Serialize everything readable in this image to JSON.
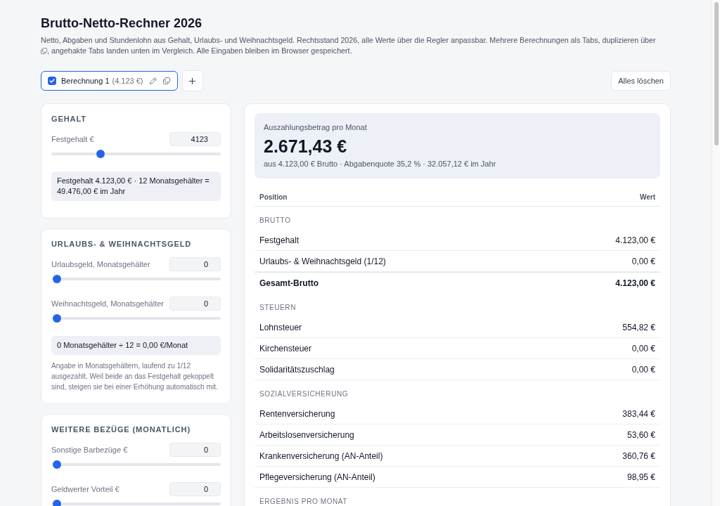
{
  "page": {
    "title": "Brutto-Netto-Rechner 2026",
    "description": {
      "before_icon": "Netto, Abgaben und Stundenlohn aus Gehalt, Urlaubs- und Weihnachtsgeld. Rechtsstand 2026, alle Werte über die Regler anpassbar. Mehrere Berechnungen als Tabs, duplizieren über",
      "after_icon": ", angehakte Tabs landen unten im Vergleich. Alle Eingaben bleiben im Browser gespeichert."
    }
  },
  "tabs": [
    {
      "label": "Berechnung 1",
      "amount": "(4.123 €)",
      "checked": true,
      "selected": true
    }
  ],
  "toolbar": {
    "clear_button": "Alles löschen"
  },
  "input_cards": [
    {
      "title": "GEHALT",
      "fields": [
        {
          "label": "Festgehalt €",
          "value": "4123",
          "level": 0.275
        }
      ],
      "formula": "Festgehalt 4.123,00 € · 12 Monatsgehälter = 49.476,00 € im Jahr"
    },
    {
      "title": "URLAUBS- & WEIHNACHTSGELD",
      "fields": [
        {
          "label": "Urlaubsgeld, Monatsgehälter",
          "value": "0",
          "level": 0
        },
        {
          "label": "Weihnachtsgeld, Monatsgehälter",
          "value": "0",
          "level": 0
        }
      ],
      "formula": "0 Monatsgehälter ÷ 12 = 0,00 €/Monat",
      "note": "Angabe in Monatsgehältern, laufend zu 1/12 ausgezahlt. Weil beide an das Festgehalt gekoppelt sind, steigen sie bei einer Erhöhung automatisch mit."
    },
    {
      "title": "WEITERE BEZÜGE (MONATLICH)",
      "fields": [
        {
          "label": "Sonstige Barbezüge €",
          "value": "0",
          "level": 0
        },
        {
          "label": "Geldwerter Vorteil €",
          "value": "0",
          "level": 0
        }
      ]
    }
  ],
  "result": {
    "summary": {
      "label": "Auszahlungsbetrag pro Monat",
      "amount": "2.671,43 €",
      "details": "aus 4.123,00 € Brutto · Abgabenquote 35,2 % · 32.057,12 € im Jahr"
    },
    "table": {
      "columns": [
        "Position",
        "Wert"
      ],
      "sections": [
        {
          "title": "BRUTTO",
          "rows": [
            {
              "label": "Festgehalt",
              "value": "4.123,00 €",
              "kind": "item"
            },
            {
              "label": "Urlaubs- & Weihnachtsgeld (1/12)",
              "value": "0,00 €",
              "kind": "item"
            },
            {
              "label": "Gesamt-Brutto",
              "value": "4.123,00 €",
              "kind": "total"
            }
          ]
        },
        {
          "title": "STEUERN",
          "rows": [
            {
              "label": "Lohnsteuer",
              "value": "554,82 €",
              "kind": "item"
            },
            {
              "label": "Kirchensteuer",
              "value": "0,00 €",
              "kind": "item"
            },
            {
              "label": "Solidaritätszuschlag",
              "value": "0,00 €",
              "kind": "item"
            }
          ]
        },
        {
          "title": "SOZIALVERSICHERUNG",
          "rows": [
            {
              "label": "Rentenversicherung",
              "value": "383,44 €",
              "kind": "item"
            },
            {
              "label": "Arbeitslosenversicherung",
              "value": "53,60 €",
              "kind": "item"
            },
            {
              "label": "Krankenversicherung (AN-Anteil)",
              "value": "360,76 €",
              "kind": "item"
            },
            {
              "label": "Pflegeversicherung (AN-Anteil)",
              "value": "98,95 €",
              "kind": "item"
            }
          ]
        },
        {
          "title": "ERGEBNIS PRO MONAT"
        }
      ]
    }
  }
}
